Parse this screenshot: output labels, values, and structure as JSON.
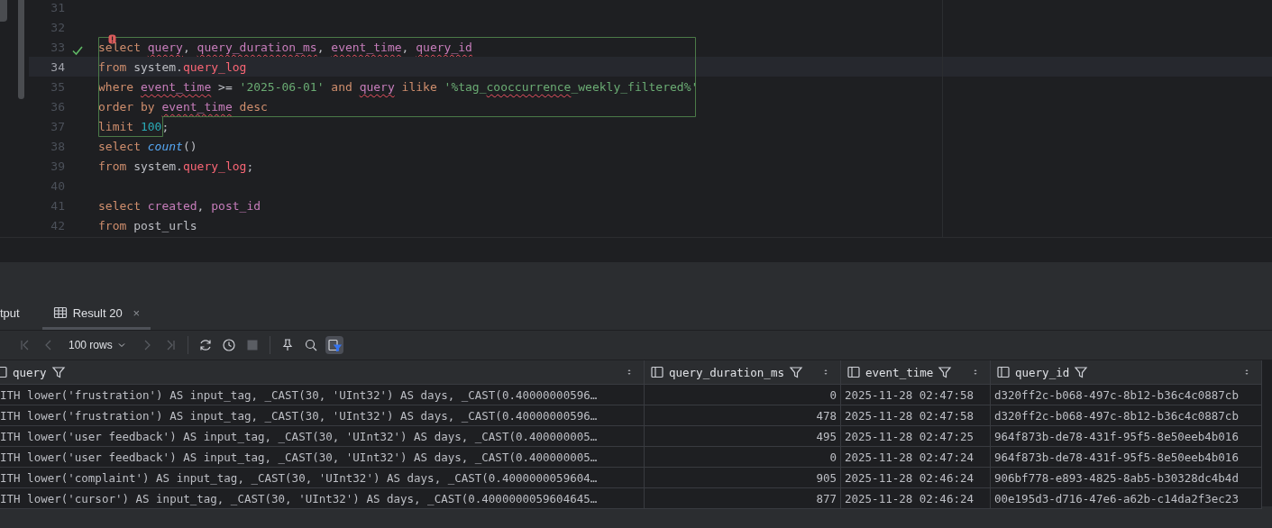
{
  "editor": {
    "lines": [
      {
        "number": "31",
        "current": false,
        "check": false,
        "error_marker": false
      },
      {
        "number": "32",
        "current": false,
        "check": false,
        "error_marker": false
      },
      {
        "number": "33",
        "current": false,
        "check": true,
        "error_marker": true,
        "tokens": [
          {
            "text": "select ",
            "kind": "keyword"
          },
          {
            "text": "query",
            "kind": "column-warn"
          },
          {
            "text": ", ",
            "kind": "plain"
          },
          {
            "text": "query_duration_ms",
            "kind": "column-warn"
          },
          {
            "text": ", ",
            "kind": "plain"
          },
          {
            "text": "event_time",
            "kind": "column-warn"
          },
          {
            "text": ", ",
            "kind": "plain"
          },
          {
            "text": "query_id",
            "kind": "column-warn"
          }
        ]
      },
      {
        "number": "34",
        "current": true,
        "check": false,
        "error_marker": false,
        "tokens": [
          {
            "text": "from",
            "kind": "keyword"
          },
          {
            "text": " system.",
            "kind": "plain"
          },
          {
            "text": "query_log",
            "kind": "table"
          }
        ]
      },
      {
        "number": "35",
        "current": false,
        "check": false,
        "error_marker": false,
        "tokens": [
          {
            "text": "where ",
            "kind": "keyword"
          },
          {
            "text": "event_time",
            "kind": "column-warn"
          },
          {
            "text": " >= ",
            "kind": "plain"
          },
          {
            "text": "'2025-06-01'",
            "kind": "string"
          },
          {
            "text": " and ",
            "kind": "keyword"
          },
          {
            "text": "query",
            "kind": "column-warn"
          },
          {
            "text": " ilike ",
            "kind": "keyword"
          },
          {
            "text": "'%tag_",
            "kind": "string"
          },
          {
            "text": "cooccurrence",
            "kind": "string-warn"
          },
          {
            "text": "_weekly_filtered%'",
            "kind": "string"
          }
        ]
      },
      {
        "number": "36",
        "current": false,
        "check": false,
        "error_marker": false,
        "tokens": [
          {
            "text": "order by ",
            "kind": "keyword"
          },
          {
            "text": "event_time",
            "kind": "column-warn"
          },
          {
            "text": " desc",
            "kind": "keyword"
          }
        ]
      },
      {
        "number": "37",
        "current": false,
        "check": false,
        "error_marker": false,
        "tokens": [
          {
            "text": "limit ",
            "kind": "keyword"
          },
          {
            "text": "100",
            "kind": "number"
          },
          {
            "text": ";",
            "kind": "plain"
          }
        ]
      },
      {
        "number": "38",
        "current": false,
        "check": false,
        "error_marker": false,
        "tokens": [
          {
            "text": "select ",
            "kind": "keyword"
          },
          {
            "text": "count",
            "kind": "function"
          },
          {
            "text": "()",
            "kind": "plain"
          }
        ]
      },
      {
        "number": "39",
        "current": false,
        "check": false,
        "error_marker": false,
        "tokens": [
          {
            "text": "from",
            "kind": "keyword"
          },
          {
            "text": " system.",
            "kind": "plain"
          },
          {
            "text": "query_log",
            "kind": "table"
          },
          {
            "text": ";",
            "kind": "plain"
          }
        ]
      },
      {
        "number": "40",
        "current": false,
        "check": false,
        "error_marker": false
      },
      {
        "number": "41",
        "current": false,
        "check": false,
        "error_marker": false,
        "tokens": [
          {
            "text": "select ",
            "kind": "keyword"
          },
          {
            "text": "created",
            "kind": "column"
          },
          {
            "text": ", ",
            "kind": "plain"
          },
          {
            "text": "post_id",
            "kind": "column"
          }
        ]
      },
      {
        "number": "42",
        "current": false,
        "check": false,
        "error_marker": false,
        "tokens": [
          {
            "text": "from",
            "kind": "keyword"
          },
          {
            "text": " post_urls",
            "kind": "plain"
          }
        ]
      }
    ]
  },
  "results": {
    "tabs": [
      {
        "label": "tput",
        "selected": false,
        "closable": false
      },
      {
        "label": "Result 20",
        "selected": true,
        "closable": true
      }
    ],
    "close_glyph": "×",
    "page_size": "100 rows",
    "table": {
      "columns": [
        "query",
        "query_duration_ms",
        "event_time",
        "query_id"
      ],
      "rows": [
        [
          "ITH lower('frustration') AS input_tag, _CAST(30, 'UInt32') AS days, _CAST(0.40000000596…",
          "0",
          "2025-11-28 02:47:58",
          "d320ff2c-b068-497c-8b12-b36c4c0887cb"
        ],
        [
          "ITH lower('frustration') AS input_tag, _CAST(30, 'UInt32') AS days, _CAST(0.40000000596…",
          "478",
          "2025-11-28 02:47:58",
          "d320ff2c-b068-497c-8b12-b36c4c0887cb"
        ],
        [
          "ITH lower('user feedback') AS input_tag, _CAST(30, 'UInt32') AS days, _CAST(0.400000005…",
          "495",
          "2025-11-28 02:47:25",
          "964f873b-de78-431f-95f5-8e50eeb4b016"
        ],
        [
          "ITH lower('user feedback') AS input_tag, _CAST(30, 'UInt32') AS days, _CAST(0.400000005…",
          "0",
          "2025-11-28 02:47:24",
          "964f873b-de78-431f-95f5-8e50eeb4b016"
        ],
        [
          "ITH lower('complaint') AS input_tag, _CAST(30, 'UInt32') AS days, _CAST(0.4000000059604…",
          "905",
          "2025-11-28 02:46:24",
          "906bf778-e893-4825-8ab5-b30328dc4b4d"
        ],
        [
          "ITH lower('cursor') AS input_tag, _CAST(30, 'UInt32') AS days, _CAST(0.4000000059604645…",
          "877",
          "2025-11-28 02:46:24",
          "00e195d3-d716-47e6-a62b-c14da2f3ec23"
        ]
      ]
    }
  }
}
